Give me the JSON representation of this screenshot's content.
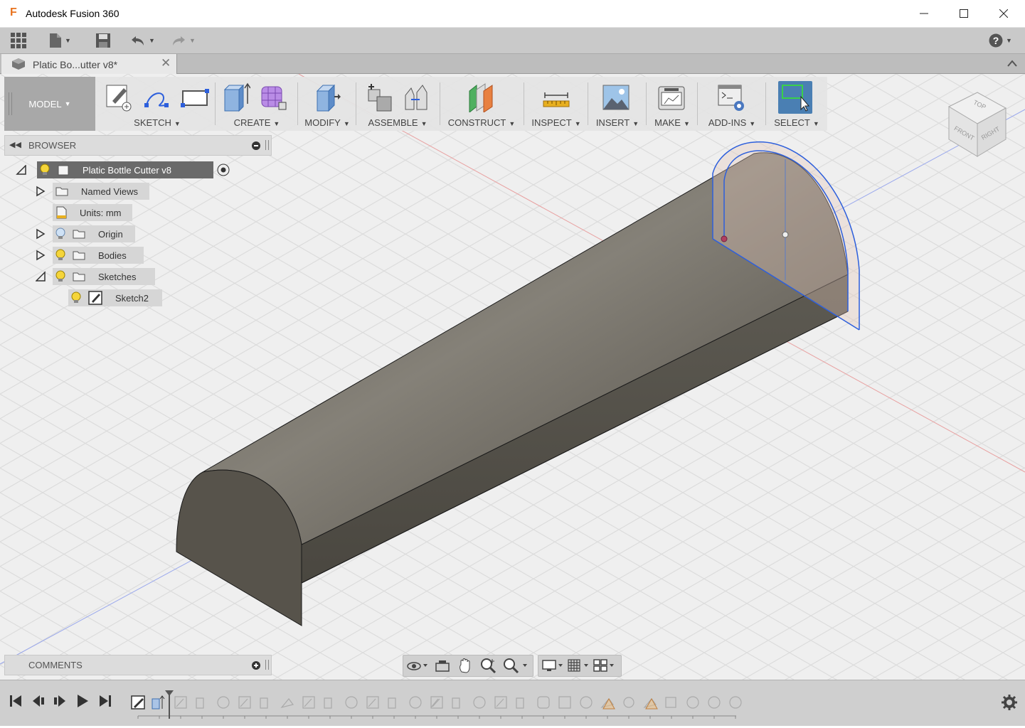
{
  "window": {
    "title": "Autodesk Fusion 360",
    "app_icon_letter": "F",
    "controls": [
      "minimize",
      "maximize",
      "close"
    ]
  },
  "quick_access": {
    "items": [
      "grid-menu-icon",
      "file-icon",
      "save-icon",
      "undo-icon",
      "redo-icon"
    ],
    "help_icon": "help-icon"
  },
  "doc_tab": {
    "label": "Platic Bo...utter v8*",
    "close_glyph": "✕"
  },
  "toolbar": {
    "workspace": "MODEL",
    "groups": [
      {
        "label": "SKETCH",
        "icons": [
          "create-sketch-icon",
          "spline-icon",
          "rectangle-icon"
        ]
      },
      {
        "label": "CREATE",
        "icons": [
          "extrude-icon",
          "form-icon"
        ]
      },
      {
        "label": "MODIFY",
        "icons": [
          "press-pull-icon"
        ]
      },
      {
        "label": "ASSEMBLE",
        "icons": [
          "new-component-icon",
          "joint-icon"
        ]
      },
      {
        "label": "CONSTRUCT",
        "icons": [
          "offset-plane-icon"
        ]
      },
      {
        "label": "INSPECT",
        "icons": [
          "measure-icon"
        ]
      },
      {
        "label": "INSERT",
        "icons": [
          "insert-image-icon"
        ]
      },
      {
        "label": "MAKE",
        "icons": [
          "3d-print-icon"
        ]
      },
      {
        "label": "ADD-INS",
        "icons": [
          "scripts-icon"
        ]
      },
      {
        "label": "SELECT",
        "icons": [
          "select-icon"
        ]
      }
    ],
    "accent_select": "#4a7fb3"
  },
  "browser": {
    "title": "BROWSER",
    "root": "Platic Bottle Cutter v8",
    "items": [
      {
        "label": "Named Views"
      },
      {
        "label": "Units: mm"
      },
      {
        "label": "Origin"
      },
      {
        "label": "Bodies"
      },
      {
        "label": "Sketches"
      },
      {
        "label": "Sketch2"
      }
    ]
  },
  "comments": {
    "title": "COMMENTS"
  },
  "viewcube": {
    "top": "TOP",
    "front": "FRONT",
    "right": "RIGHT"
  },
  "navbar": {
    "icons": [
      "orbit-icon",
      "look-at-icon",
      "pan-icon",
      "zoom-icon",
      "zoom-window-icon",
      "display-settings-icon",
      "grid-settings-icon",
      "viewports-icon"
    ]
  },
  "timeline": {
    "controls": [
      "go-start-icon",
      "step-back-icon",
      "play-icon",
      "step-forward-icon",
      "go-end-icon"
    ],
    "settings_icon": "gear-icon"
  },
  "colors": {
    "body": "#5e5a52",
    "sketch_line": "#2d5fdc",
    "axis_red": "#e07070",
    "axis_blue": "#6f86e8"
  }
}
